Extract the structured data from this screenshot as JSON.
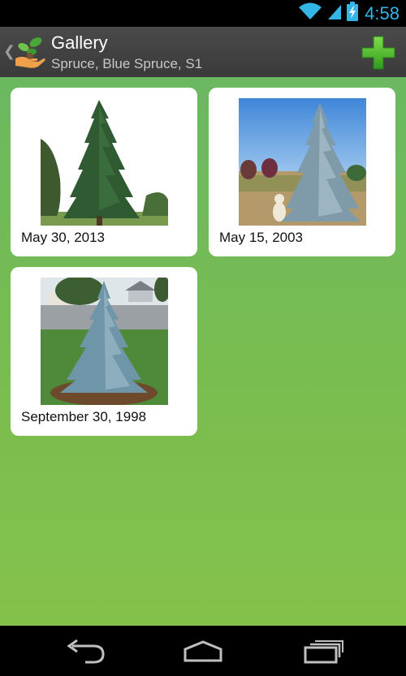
{
  "status_bar": {
    "time": "4:58",
    "icons": [
      "wifi-icon",
      "signal-icon",
      "battery-charging-icon"
    ],
    "accent_color": "#33b5e5"
  },
  "action_bar": {
    "title": "Gallery",
    "subtitle": "Spruce, Blue Spruce, S1",
    "up_icon": "chevron-left-icon",
    "logo_icon": "plant-in-hand-icon",
    "action_icon": "add-plus-icon",
    "background_color": "#444444"
  },
  "gallery": {
    "background_color": "#78bc53",
    "items": [
      {
        "date": "May 30, 2013",
        "photo": "tall green spruce tree on lawn"
      },
      {
        "date": "May 15, 2003",
        "photo": "blue spruce in field with dog and blue sky"
      },
      {
        "date": "September 30, 1998",
        "photo": "young blue spruce in yard"
      }
    ]
  },
  "nav_bar": {
    "icons": [
      "back-icon",
      "home-icon",
      "recent-apps-icon"
    ]
  }
}
